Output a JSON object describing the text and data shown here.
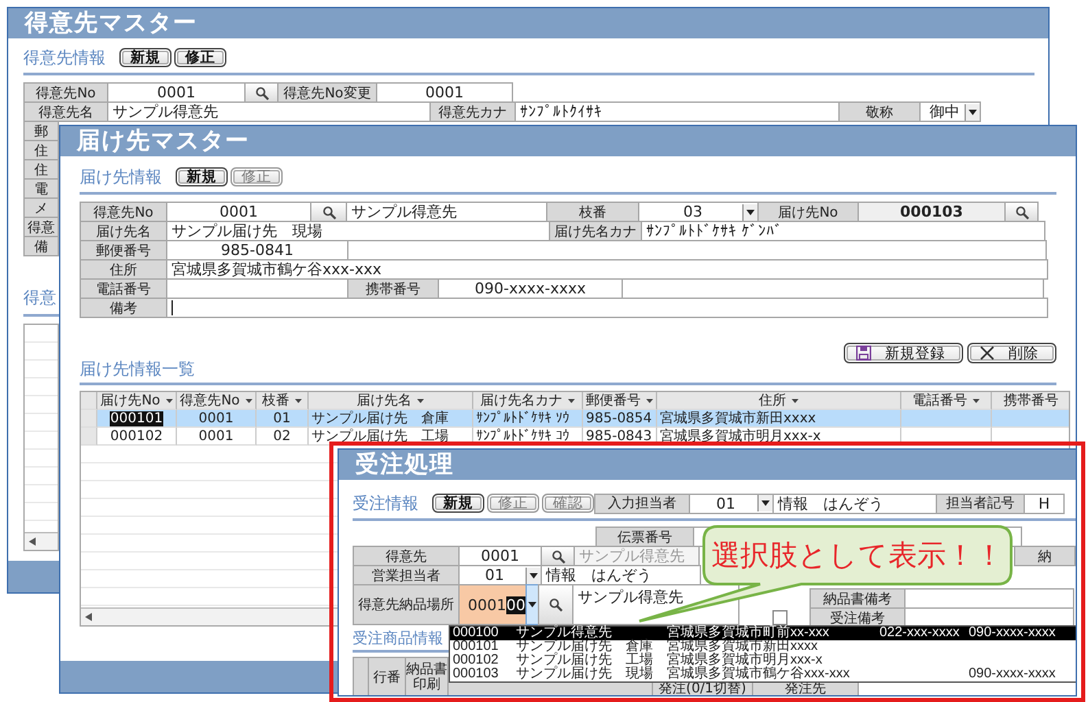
{
  "customer_master": {
    "title": "得意先マスター",
    "section": "得意先情報",
    "buttons": [
      {
        "label": "新規",
        "disabled": false
      },
      {
        "label": "修正",
        "disabled": false
      }
    ],
    "fields": [
      {
        "kind": "label",
        "text": "得意先No"
      },
      {
        "kind": "value",
        "text": "0001"
      },
      {
        "kind": "search"
      },
      {
        "kind": "label",
        "text": "得意先No変更"
      },
      {
        "kind": "value",
        "text": "0001"
      },
      {
        "kind": "label",
        "text": "得意先名"
      },
      {
        "kind": "text",
        "text": "サンプル得意先"
      },
      {
        "kind": "label",
        "text": "得意先カナ"
      },
      {
        "kind": "text",
        "text": "ｻﾝﾌﾟﾙﾄｸｲｻｷ"
      },
      {
        "kind": "label",
        "text": "敬称"
      },
      {
        "kind": "combo",
        "text": "御中"
      }
    ],
    "covered_labels": [
      "郵",
      "住",
      "住",
      "電",
      "メ",
      "得意",
      "備"
    ],
    "list_heading": "得意"
  },
  "destination_master": {
    "title": "届け先マスター",
    "section": "届け先情報",
    "buttons": [
      {
        "label": "新規",
        "disabled": false
      },
      {
        "label": "修正",
        "disabled": true
      }
    ],
    "fields": [
      {
        "kind": "label",
        "text": "得意先No"
      },
      {
        "kind": "value",
        "text": "0001"
      },
      {
        "kind": "search"
      },
      {
        "kind": "text",
        "text": "サンプル得意先"
      },
      {
        "kind": "label",
        "text": "枝番"
      },
      {
        "kind": "combo",
        "text": "03"
      },
      {
        "kind": "label",
        "text": "届け先No"
      },
      {
        "kind": "readonly",
        "text": "000103"
      },
      {
        "kind": "search"
      },
      {
        "kind": "label",
        "text": "届け先名"
      },
      {
        "kind": "text",
        "text": "サンプル届け先　現場"
      },
      {
        "kind": "label",
        "text": "届け先名カナ"
      },
      {
        "kind": "text",
        "text": "ｻﾝﾌﾟﾙﾄﾄﾞｹｻｷ ｹﾞﾝﾊﾞ"
      },
      {
        "kind": "label",
        "text": "郵便番号"
      },
      {
        "kind": "value",
        "text": "985-0841"
      },
      {
        "kind": "blank"
      },
      {
        "kind": "label",
        "text": "住所"
      },
      {
        "kind": "text",
        "text": "宮城県多賀城市鶴ケ谷xxx-xxx"
      },
      {
        "kind": "label",
        "text": "電話番号"
      },
      {
        "kind": "blank"
      },
      {
        "kind": "label",
        "text": "携帯番号"
      },
      {
        "kind": "value",
        "text": "090-xxxx-xxxx"
      },
      {
        "kind": "blank"
      },
      {
        "kind": "label",
        "text": "備考"
      },
      {
        "kind": "input"
      }
    ],
    "actions": [
      {
        "kind": "save",
        "label": "新規登録"
      },
      {
        "kind": "delete",
        "label": "削除"
      }
    ],
    "list": {
      "heading": "届け先情報一覧",
      "columns": [
        {
          "label": "届け先No",
          "sort": true
        },
        {
          "label": "得意先No",
          "sort": true
        },
        {
          "label": "枝番",
          "sort": true
        },
        {
          "label": "届け先名",
          "sort": true
        },
        {
          "label": "届け先名カナ",
          "sort": true
        },
        {
          "label": "郵便番号",
          "sort": true
        },
        {
          "label": "住所",
          "sort": true
        },
        {
          "label": "電話番号",
          "sort": true
        },
        {
          "label": "携帯番号",
          "sort": false
        }
      ],
      "rows": [
        {
          "selected": true,
          "key_highlighted": true,
          "cells": [
            "000101",
            "0001",
            "01",
            "サンプル届け先　倉庫",
            "ｻﾝﾌﾟﾙﾄﾄﾞｹｻｷ ｿｳ",
            "985-0854",
            "宮城県多賀城市新田xxxx"
          ]
        },
        {
          "selected": false,
          "key_highlighted": false,
          "cells": [
            "000102",
            "0001",
            "02",
            "サンプル届け先　工場",
            "ｻﾝﾌﾟﾙﾄﾄﾞｹｻｷ ｺｳ",
            "985-0843",
            "宮城県多賀城市明月xxx-x"
          ]
        }
      ]
    }
  },
  "order_entry": {
    "title": "受注処理",
    "section": "受注情報",
    "buttons": [
      {
        "label": "新規",
        "disabled": false
      },
      {
        "label": "修正",
        "disabled": true
      },
      {
        "label": "確認",
        "disabled": true
      }
    ],
    "staff": [
      {
        "kind": "label",
        "text": "入力担当者"
      },
      {
        "kind": "combo",
        "text": "01"
      },
      {
        "kind": "text",
        "text": "情報　はんぞう"
      },
      {
        "kind": "label",
        "text": "担当者記号"
      },
      {
        "kind": "value",
        "text": "H"
      }
    ],
    "slip": [
      {
        "kind": "label",
        "text": "伝票番号"
      },
      {
        "kind": "blank"
      }
    ],
    "fields": [
      {
        "kind": "label",
        "text": "得意先"
      },
      {
        "kind": "value",
        "text": "0001"
      },
      {
        "kind": "search"
      },
      {
        "kind": "muted",
        "text": "サンプル得意先"
      },
      {
        "kind": "label",
        "text": "営業担当者"
      },
      {
        "kind": "combo",
        "text": "01"
      },
      {
        "kind": "text",
        "text": "情報　はんぞう"
      },
      {
        "kind": "label",
        "text": "得意先納品場所"
      },
      {
        "kind": "active",
        "text": "0001",
        "selection": "00"
      },
      {
        "kind": "dropbtn"
      },
      {
        "kind": "search"
      },
      {
        "kind": "text",
        "text": "サンプル得意先"
      }
    ],
    "side": {
      "top_label": "納",
      "checkbox": {
        "checked": false
      },
      "labels": [
        "納品書備考",
        "受注備考"
      ]
    },
    "dropdown": [
      {
        "selected": true,
        "code": "000100",
        "name": "サンプル得意先",
        "address": "宮城県多賀城市町前xx-xxx",
        "phone": "022-xxx-xxxx",
        "mobile": "090-xxxx-xxxx"
      },
      {
        "selected": false,
        "code": "000101",
        "name": "サンプル届け先　倉庫",
        "address": "宮城県多賀城市新田xxxx"
      },
      {
        "selected": false,
        "code": "000102",
        "name": "サンプル届け先　工場",
        "address": "宮城県多賀城市明月xxx-x"
      },
      {
        "selected": false,
        "code": "000103",
        "name": "サンプル届け先　現場",
        "address": "宮城県多賀城市鶴ケ谷xxx-xxx",
        "mobile": "090-xxxx-xxxx"
      }
    ],
    "product_section": "受注商品情報",
    "product_columns": [
      "行番",
      "納品書印刷",
      "発注(0/1切替)",
      "発注先"
    ]
  },
  "callout": {
    "text": "選択肢として表示！！"
  }
}
